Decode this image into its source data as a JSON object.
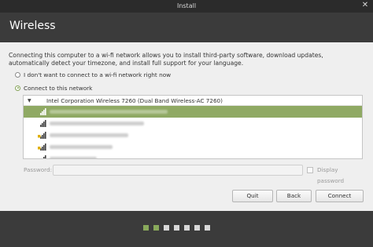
{
  "window": {
    "title": "Install"
  },
  "header": {
    "title": "Wireless"
  },
  "description": "Connecting this computer to a wi-fi network allows you to install third-party software, download updates, automatically detect your timezone, and install full support for your language.",
  "options": {
    "no_connect": "I don't want to connect to a wi-fi network right now",
    "connect": "Connect to this network",
    "selected": "connect"
  },
  "network_list": {
    "adapter": "Intel Corporation Wireless 7260 (Dual Band Wireless-AC 7260)",
    "networks": [
      {
        "name": "",
        "selected": true,
        "secure": false
      },
      {
        "name": "",
        "selected": false,
        "secure": false
      },
      {
        "name": "",
        "selected": false,
        "secure": true
      },
      {
        "name": "",
        "selected": false,
        "secure": true
      },
      {
        "name": "",
        "selected": false,
        "secure": true
      }
    ]
  },
  "password": {
    "label": "Password:",
    "value": "",
    "show_label": "Display password"
  },
  "buttons": {
    "quit": "Quit",
    "back": "Back",
    "connect": "Connect"
  },
  "progress": {
    "completed": 2,
    "total": 7
  },
  "colors": {
    "accent": "#8fa963",
    "dark": "#3b3b3b"
  }
}
